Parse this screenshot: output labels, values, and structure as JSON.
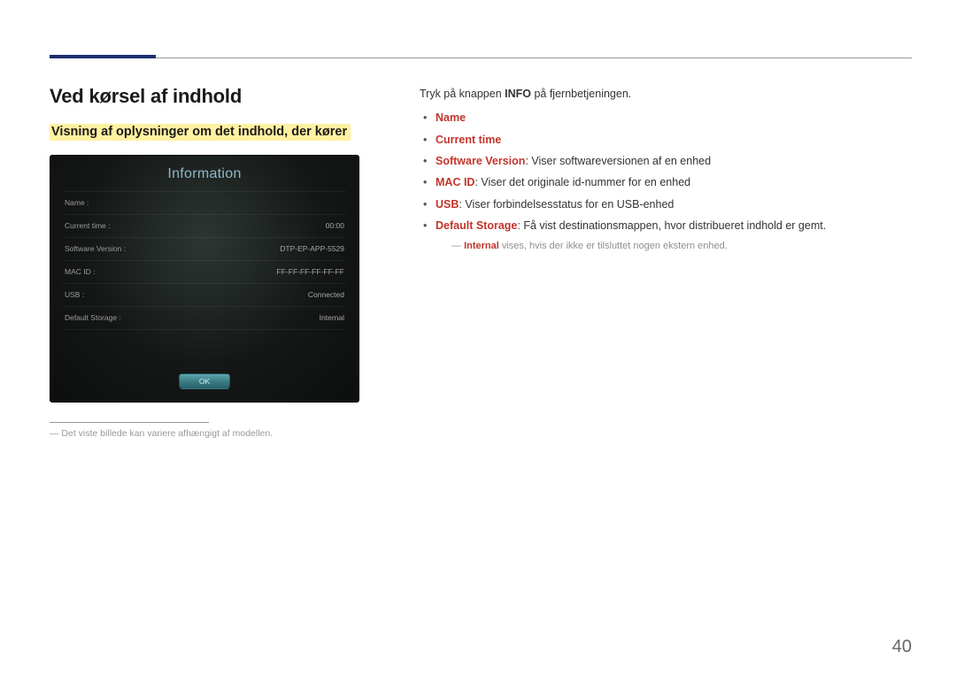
{
  "pageNumber": "40",
  "heading": "Ved kørsel af indhold",
  "subheading": "Visning af oplysninger om det indhold, der kører",
  "panel": {
    "title": "Information",
    "rows": [
      {
        "label": "Name :",
        "value": ""
      },
      {
        "label": "Current time :",
        "value": "00:00"
      },
      {
        "label": "Software Version :",
        "value": "DTP-EP-APP-5529"
      },
      {
        "label": "MAC ID :",
        "value": "FF-FF-FF-FF-FF-FF"
      },
      {
        "label": "USB :",
        "value": "Connected"
      },
      {
        "label": "Default Storage :",
        "value": "Internal"
      }
    ],
    "ok": "OK"
  },
  "panelNote": "Det viste billede kan variere afhængigt af modellen.",
  "intro": {
    "pre": "Tryk på knappen ",
    "boldWord": "INFO",
    "post": " på fjernbetjeningen."
  },
  "bullets": {
    "b1": "Name",
    "b2": "Current time",
    "b3_bold": "Software Version",
    "b3_text": ": Viser softwareversionen af en enhed",
    "b4_bold": "MAC ID",
    "b4_text": ": Viser det originale id-nummer for en enhed",
    "b5_bold": "USB",
    "b5_text": ": Viser forbindelsesstatus for en USB-enhed",
    "b6_bold": "Default Storage",
    "b6_text": ": Få vist destinationsmappen, hvor distribueret indhold er gemt."
  },
  "subnote": {
    "boldWord": "Internal",
    "rest": " vises, hvis der ikke er tilsluttet nogen ekstern enhed."
  }
}
